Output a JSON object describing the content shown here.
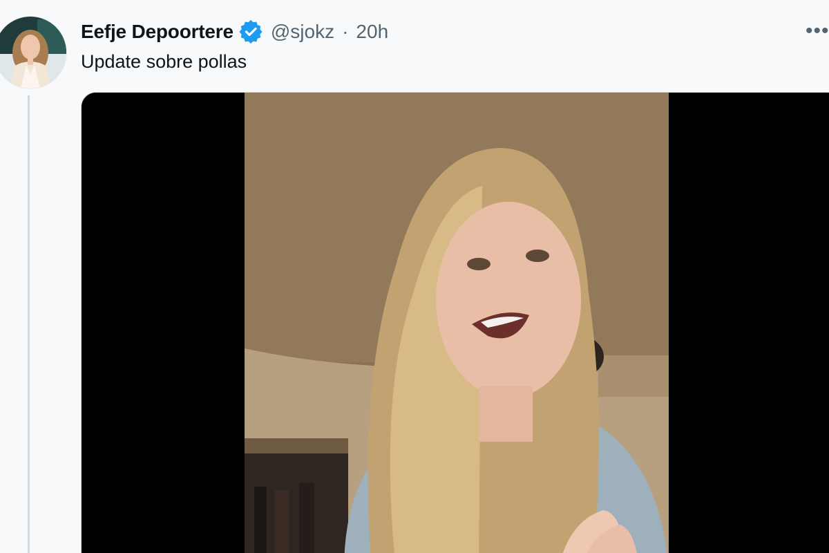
{
  "tweet": {
    "author": {
      "display_name": "Eefje Depoortere",
      "verified_icon": "verified-badge-icon",
      "handle": "@sjokz",
      "avatar_icon": "user-avatar"
    },
    "separator": "·",
    "timestamp": "20h",
    "more_icon": "more-options-icon",
    "more_label": "•••",
    "text": "Update sobre pollas",
    "media": {
      "type": "video"
    }
  },
  "colors": {
    "verified_blue": "#1d9bf0",
    "text_primary": "#0f1419",
    "text_secondary": "#536471",
    "thread_line": "#cfd9de",
    "video_letterbox": "#000000"
  }
}
